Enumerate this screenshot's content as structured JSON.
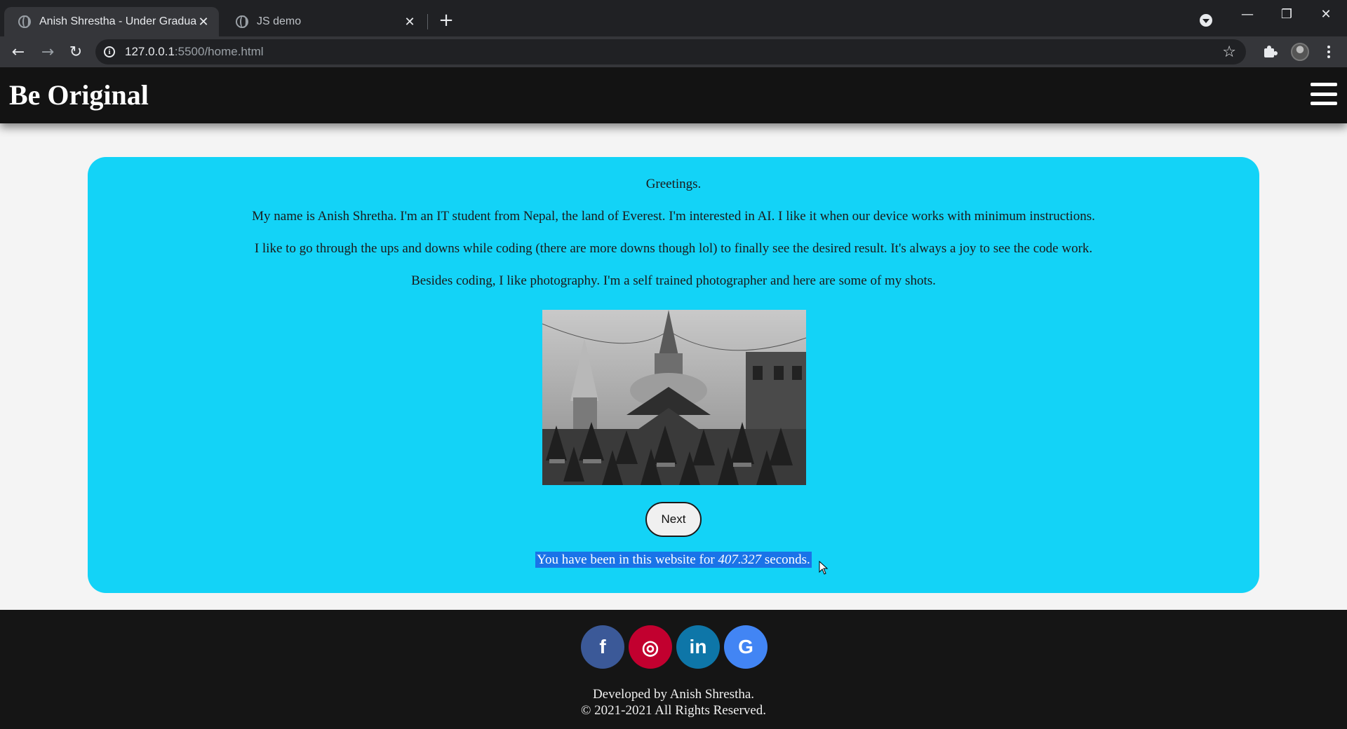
{
  "browser": {
    "tabs": [
      {
        "title": "Anish Shrestha - Under Graduate",
        "active": true
      },
      {
        "title": "JS demo",
        "active": false
      }
    ],
    "url_host": "127.0.0.1",
    "url_path": ":5500/home.html"
  },
  "site": {
    "brand": "Be Original",
    "card": {
      "greeting": "Greetings.",
      "paragraphs": [
        "My name is Anish Shretha. I'm an IT student from Nepal, the land of Everest. I'm interested in AI. I like it when our device works with minimum instructions.",
        "I like to go through the ups and downs while coding (there are more downs though lol) to finally see the desired result. It's always a joy to see the code work.",
        "Besides coding, I like photography. I'm a self trained photographer and here are some of my shots."
      ],
      "next_label": "Next",
      "timer_prefix": "You have been in this website for ",
      "timer_value": "407.327",
      "timer_suffix": " seconds.",
      "bg_color": "#13d3f7"
    },
    "footer": {
      "socials": [
        {
          "name": "facebook",
          "glyph": "f",
          "color": "#3b5998"
        },
        {
          "name": "instagram",
          "glyph": "◎",
          "color": "#c2002f"
        },
        {
          "name": "linkedin",
          "glyph": "in",
          "color": "#0e76a8"
        },
        {
          "name": "google",
          "glyph": "G",
          "color": "#4285f4"
        }
      ],
      "developed_by": "Developed by Anish Shrestha.",
      "copyright": "© 2021-2021 All Rights Reserved."
    }
  }
}
